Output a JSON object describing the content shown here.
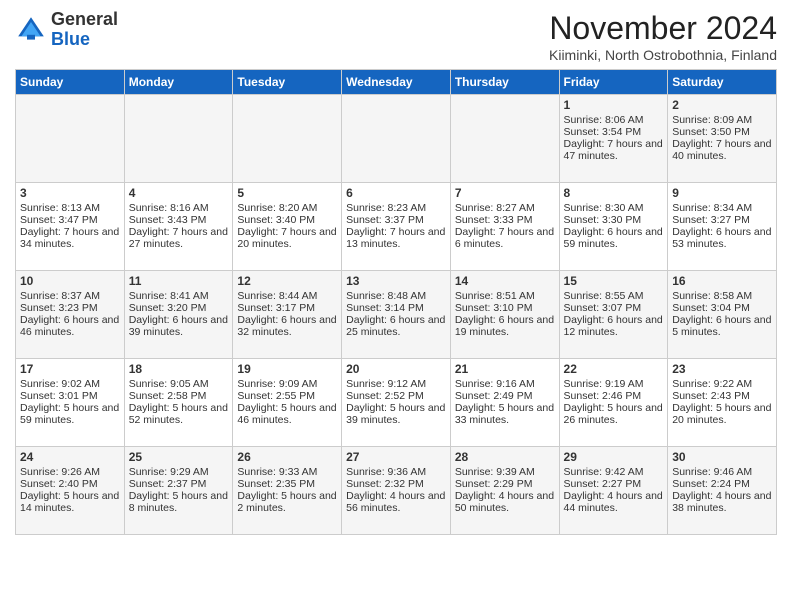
{
  "logo": {
    "general": "General",
    "blue": "Blue"
  },
  "header": {
    "title": "November 2024",
    "subtitle": "Kiiminki, North Ostrobothnia, Finland"
  },
  "weekdays": [
    "Sunday",
    "Monday",
    "Tuesday",
    "Wednesday",
    "Thursday",
    "Friday",
    "Saturday"
  ],
  "weeks": [
    [
      {
        "day": "",
        "sunrise": "",
        "sunset": "",
        "daylight": ""
      },
      {
        "day": "",
        "sunrise": "",
        "sunset": "",
        "daylight": ""
      },
      {
        "day": "",
        "sunrise": "",
        "sunset": "",
        "daylight": ""
      },
      {
        "day": "",
        "sunrise": "",
        "sunset": "",
        "daylight": ""
      },
      {
        "day": "",
        "sunrise": "",
        "sunset": "",
        "daylight": ""
      },
      {
        "day": "1",
        "sunrise": "Sunrise: 8:06 AM",
        "sunset": "Sunset: 3:54 PM",
        "daylight": "Daylight: 7 hours and 47 minutes."
      },
      {
        "day": "2",
        "sunrise": "Sunrise: 8:09 AM",
        "sunset": "Sunset: 3:50 PM",
        "daylight": "Daylight: 7 hours and 40 minutes."
      }
    ],
    [
      {
        "day": "3",
        "sunrise": "Sunrise: 8:13 AM",
        "sunset": "Sunset: 3:47 PM",
        "daylight": "Daylight: 7 hours and 34 minutes."
      },
      {
        "day": "4",
        "sunrise": "Sunrise: 8:16 AM",
        "sunset": "Sunset: 3:43 PM",
        "daylight": "Daylight: 7 hours and 27 minutes."
      },
      {
        "day": "5",
        "sunrise": "Sunrise: 8:20 AM",
        "sunset": "Sunset: 3:40 PM",
        "daylight": "Daylight: 7 hours and 20 minutes."
      },
      {
        "day": "6",
        "sunrise": "Sunrise: 8:23 AM",
        "sunset": "Sunset: 3:37 PM",
        "daylight": "Daylight: 7 hours and 13 minutes."
      },
      {
        "day": "7",
        "sunrise": "Sunrise: 8:27 AM",
        "sunset": "Sunset: 3:33 PM",
        "daylight": "Daylight: 7 hours and 6 minutes."
      },
      {
        "day": "8",
        "sunrise": "Sunrise: 8:30 AM",
        "sunset": "Sunset: 3:30 PM",
        "daylight": "Daylight: 6 hours and 59 minutes."
      },
      {
        "day": "9",
        "sunrise": "Sunrise: 8:34 AM",
        "sunset": "Sunset: 3:27 PM",
        "daylight": "Daylight: 6 hours and 53 minutes."
      }
    ],
    [
      {
        "day": "10",
        "sunrise": "Sunrise: 8:37 AM",
        "sunset": "Sunset: 3:23 PM",
        "daylight": "Daylight: 6 hours and 46 minutes."
      },
      {
        "day": "11",
        "sunrise": "Sunrise: 8:41 AM",
        "sunset": "Sunset: 3:20 PM",
        "daylight": "Daylight: 6 hours and 39 minutes."
      },
      {
        "day": "12",
        "sunrise": "Sunrise: 8:44 AM",
        "sunset": "Sunset: 3:17 PM",
        "daylight": "Daylight: 6 hours and 32 minutes."
      },
      {
        "day": "13",
        "sunrise": "Sunrise: 8:48 AM",
        "sunset": "Sunset: 3:14 PM",
        "daylight": "Daylight: 6 hours and 25 minutes."
      },
      {
        "day": "14",
        "sunrise": "Sunrise: 8:51 AM",
        "sunset": "Sunset: 3:10 PM",
        "daylight": "Daylight: 6 hours and 19 minutes."
      },
      {
        "day": "15",
        "sunrise": "Sunrise: 8:55 AM",
        "sunset": "Sunset: 3:07 PM",
        "daylight": "Daylight: 6 hours and 12 minutes."
      },
      {
        "day": "16",
        "sunrise": "Sunrise: 8:58 AM",
        "sunset": "Sunset: 3:04 PM",
        "daylight": "Daylight: 6 hours and 5 minutes."
      }
    ],
    [
      {
        "day": "17",
        "sunrise": "Sunrise: 9:02 AM",
        "sunset": "Sunset: 3:01 PM",
        "daylight": "Daylight: 5 hours and 59 minutes."
      },
      {
        "day": "18",
        "sunrise": "Sunrise: 9:05 AM",
        "sunset": "Sunset: 2:58 PM",
        "daylight": "Daylight: 5 hours and 52 minutes."
      },
      {
        "day": "19",
        "sunrise": "Sunrise: 9:09 AM",
        "sunset": "Sunset: 2:55 PM",
        "daylight": "Daylight: 5 hours and 46 minutes."
      },
      {
        "day": "20",
        "sunrise": "Sunrise: 9:12 AM",
        "sunset": "Sunset: 2:52 PM",
        "daylight": "Daylight: 5 hours and 39 minutes."
      },
      {
        "day": "21",
        "sunrise": "Sunrise: 9:16 AM",
        "sunset": "Sunset: 2:49 PM",
        "daylight": "Daylight: 5 hours and 33 minutes."
      },
      {
        "day": "22",
        "sunrise": "Sunrise: 9:19 AM",
        "sunset": "Sunset: 2:46 PM",
        "daylight": "Daylight: 5 hours and 26 minutes."
      },
      {
        "day": "23",
        "sunrise": "Sunrise: 9:22 AM",
        "sunset": "Sunset: 2:43 PM",
        "daylight": "Daylight: 5 hours and 20 minutes."
      }
    ],
    [
      {
        "day": "24",
        "sunrise": "Sunrise: 9:26 AM",
        "sunset": "Sunset: 2:40 PM",
        "daylight": "Daylight: 5 hours and 14 minutes."
      },
      {
        "day": "25",
        "sunrise": "Sunrise: 9:29 AM",
        "sunset": "Sunset: 2:37 PM",
        "daylight": "Daylight: 5 hours and 8 minutes."
      },
      {
        "day": "26",
        "sunrise": "Sunrise: 9:33 AM",
        "sunset": "Sunset: 2:35 PM",
        "daylight": "Daylight: 5 hours and 2 minutes."
      },
      {
        "day": "27",
        "sunrise": "Sunrise: 9:36 AM",
        "sunset": "Sunset: 2:32 PM",
        "daylight": "Daylight: 4 hours and 56 minutes."
      },
      {
        "day": "28",
        "sunrise": "Sunrise: 9:39 AM",
        "sunset": "Sunset: 2:29 PM",
        "daylight": "Daylight: 4 hours and 50 minutes."
      },
      {
        "day": "29",
        "sunrise": "Sunrise: 9:42 AM",
        "sunset": "Sunset: 2:27 PM",
        "daylight": "Daylight: 4 hours and 44 minutes."
      },
      {
        "day": "30",
        "sunrise": "Sunrise: 9:46 AM",
        "sunset": "Sunset: 2:24 PM",
        "daylight": "Daylight: 4 hours and 38 minutes."
      }
    ]
  ]
}
